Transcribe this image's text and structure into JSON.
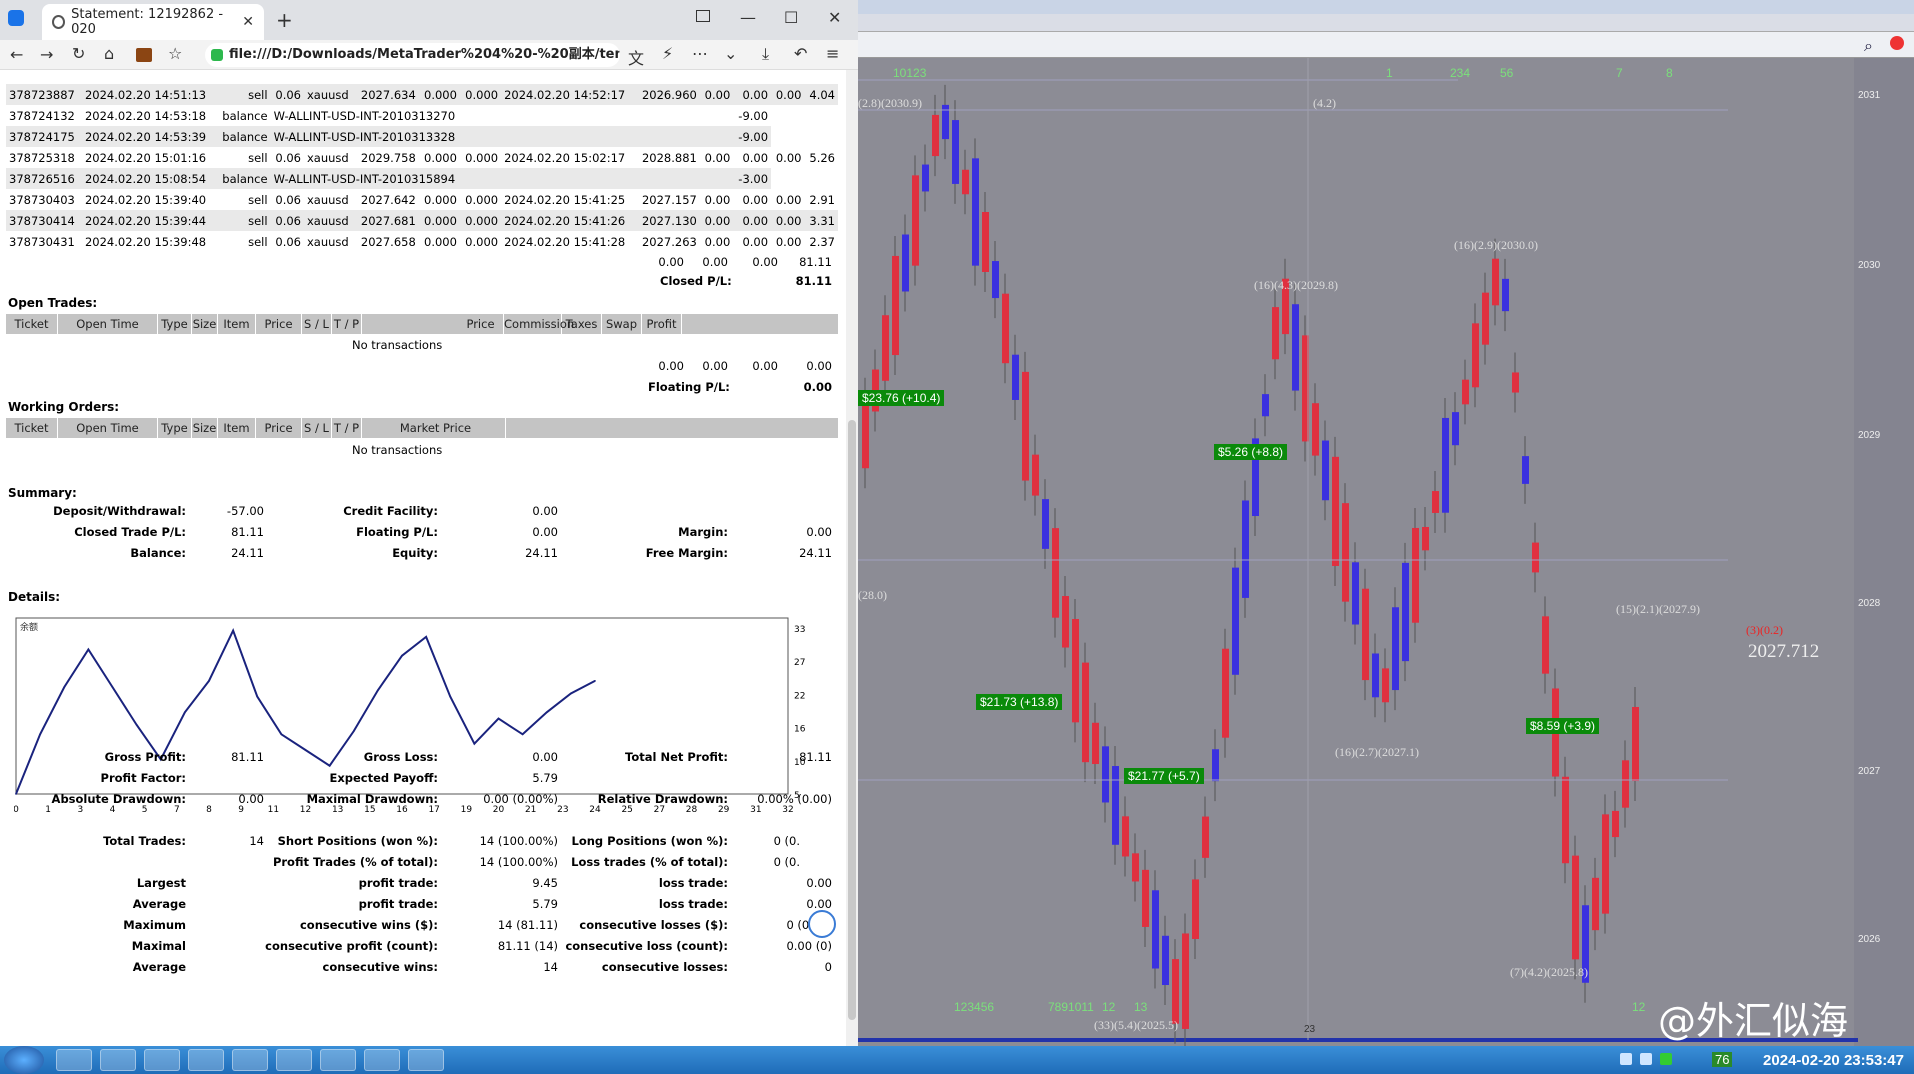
{
  "browser": {
    "tab_title": "Statement: 12192862 - 020",
    "tab_close": "✕",
    "new_tab": "+",
    "url": "file:///D:/Downloads/MetaTrader%204%20-%20副本/templ",
    "win_min": "—",
    "win_max": "☐",
    "win_close": "✕"
  },
  "transactions": [
    {
      "ticket": "378723887",
      "open_time": "2024.02.20 14:51:13",
      "type": "sell",
      "size": "0.06",
      "item": "xauusd",
      "price": "2027.634",
      "sl": "0.000",
      "tp": "0.000",
      "close_time": "2024.02.20 14:52:17",
      "close_price": "2026.960",
      "commission": "0.00",
      "taxes": "0.00",
      "swap": "0.00",
      "profit": "4.04"
    },
    {
      "ticket": "378724132",
      "open_time": "2024.02.20 14:53:18",
      "type": "balance",
      "item": "W-ALLINT-USD-INT-2010313270",
      "profit": "-9.00"
    },
    {
      "ticket": "378724175",
      "open_time": "2024.02.20 14:53:39",
      "type": "balance",
      "item": "W-ALLINT-USD-INT-2010313328",
      "profit": "-9.00"
    },
    {
      "ticket": "378725318",
      "open_time": "2024.02.20 15:01:16",
      "type": "sell",
      "size": "0.06",
      "item": "xauusd",
      "price": "2029.758",
      "sl": "0.000",
      "tp": "0.000",
      "close_time": "2024.02.20 15:02:17",
      "close_price": "2028.881",
      "commission": "0.00",
      "taxes": "0.00",
      "swap": "0.00",
      "profit": "5.26"
    },
    {
      "ticket": "378726516",
      "open_time": "2024.02.20 15:08:54",
      "type": "balance",
      "item": "W-ALLINT-USD-INT-2010315894",
      "profit": "-3.00"
    },
    {
      "ticket": "378730403",
      "open_time": "2024.02.20 15:39:40",
      "type": "sell",
      "size": "0.06",
      "item": "xauusd",
      "price": "2027.642",
      "sl": "0.000",
      "tp": "0.000",
      "close_time": "2024.02.20 15:41:25",
      "close_price": "2027.157",
      "commission": "0.00",
      "taxes": "0.00",
      "swap": "0.00",
      "profit": "2.91"
    },
    {
      "ticket": "378730414",
      "open_time": "2024.02.20 15:39:44",
      "type": "sell",
      "size": "0.06",
      "item": "xauusd",
      "price": "2027.681",
      "sl": "0.000",
      "tp": "0.000",
      "close_time": "2024.02.20 15:41:26",
      "close_price": "2027.130",
      "commission": "0.00",
      "taxes": "0.00",
      "swap": "0.00",
      "profit": "3.31"
    },
    {
      "ticket": "378730431",
      "open_time": "2024.02.20 15:39:48",
      "type": "sell",
      "size": "0.06",
      "item": "xauusd",
      "price": "2027.658",
      "sl": "0.000",
      "tp": "0.000",
      "close_time": "2024.02.20 15:41:28",
      "close_price": "2027.263",
      "commission": "0.00",
      "taxes": "0.00",
      "swap": "0.00",
      "profit": "2.37"
    }
  ],
  "closed_totals": {
    "commission": "0.00",
    "taxes": "0.00",
    "swap": "0.00",
    "profit": "81.11",
    "label": "Closed P/L:",
    "value": "81.11"
  },
  "open_trades": {
    "title": "Open Trades:",
    "headers": [
      "Ticket",
      "Open Time",
      "Type",
      "Size",
      "Item",
      "Price",
      "S / L",
      "T / P",
      "Price",
      "Commission",
      "Taxes",
      "Swap",
      "Profit"
    ],
    "empty": "No transactions",
    "commission": "0.00",
    "taxes": "0.00",
    "swap": "0.00",
    "profit": "0.00",
    "floating_label": "Floating P/L:",
    "floating_value": "0.00"
  },
  "working_orders": {
    "title": "Working Orders:",
    "headers": [
      "Ticket",
      "Open Time",
      "Type",
      "Size",
      "Item",
      "Price",
      "S / L",
      "T / P",
      "Market Price"
    ],
    "empty": "No transactions"
  },
  "summary": {
    "title": "Summary:",
    "deposit_label": "Deposit/Withdrawal:",
    "deposit": "-57.00",
    "credit_label": "Credit Facility:",
    "credit": "0.00",
    "closed_label": "Closed Trade P/L:",
    "closed": "81.11",
    "floating_label": "Floating P/L:",
    "floating": "0.00",
    "margin_label": "Margin:",
    "margin": "0.00",
    "balance_label": "Balance:",
    "balance": "24.11",
    "equity_label": "Equity:",
    "equity": "24.11",
    "free_margin_label": "Free Margin:",
    "free_margin": "24.11"
  },
  "details": {
    "title": "Details:"
  },
  "chart_data": {
    "type": "line",
    "title": "余额",
    "x": [
      0,
      1,
      2,
      3,
      4,
      5,
      6,
      7,
      8,
      9,
      10,
      11,
      12,
      13,
      14,
      15,
      16,
      17,
      18,
      19,
      20,
      21,
      22,
      23,
      24
    ],
    "values": [
      5,
      14.5,
      22,
      28,
      22,
      16,
      10.5,
      18,
      23,
      31,
      20.5,
      14.5,
      12,
      9.5,
      15,
      21.5,
      27,
      30,
      20.5,
      13,
      17,
      14.5,
      18,
      21,
      23
    ],
    "x_ticks": [
      "0",
      "1",
      "3",
      "4",
      "5",
      "7",
      "8",
      "9",
      "11",
      "12",
      "13",
      "15",
      "16",
      "17",
      "19",
      "20",
      "21",
      "23",
      "24",
      "25",
      "27",
      "28",
      "29",
      "31",
      "32"
    ],
    "y_ticks": [
      "33",
      "27",
      "22",
      "16",
      "10",
      "5"
    ],
    "ylim": [
      5,
      33
    ],
    "xlim": [
      0,
      32
    ],
    "line_color": "#1a237e"
  },
  "stats": {
    "gross_profit_label": "Gross Profit:",
    "gross_profit": "81.11",
    "gross_loss_label": "Gross Loss:",
    "gross_loss": "0.00",
    "total_net_label": "Total Net Profit:",
    "total_net": "81.11",
    "profit_factor_label": "Profit Factor:",
    "profit_factor": "",
    "expected_payoff_label": "Expected Payoff:",
    "expected_payoff": "5.79",
    "abs_dd_label": "Absolute Drawdown:",
    "abs_dd": "0.00",
    "max_dd_label": "Maximal Drawdown:",
    "max_dd": "0.00 (0.00%)",
    "rel_dd_label": "Relative Drawdown:",
    "rel_dd": "0.00% (0.00)",
    "total_trades_label": "Total Trades:",
    "total_trades": "14",
    "short_label": "Short Positions (won %):",
    "short": "14 (100.00%)",
    "long_label": "Long Positions (won %):",
    "long": "0 (0.",
    "profit_trades_label": "Profit Trades (% of total):",
    "profit_trades": "14 (100.00%)",
    "loss_trades_label": "Loss trades (% of total):",
    "loss_trades": "0 (0.",
    "largest_label": "Largest",
    "largest_profit_label": "profit trade:",
    "largest_profit": "9.45",
    "largest_loss_label": "loss trade:",
    "largest_loss": "0.00",
    "average_label": "Average",
    "average_profit_label": "profit trade:",
    "average_profit": "5.79",
    "average_loss_label": "loss trade:",
    "average_loss": "0.00",
    "maximum_label": "Maximum",
    "max_cons_wins_label": "consecutive wins ($):",
    "max_cons_wins": "14 (81.11)",
    "max_cons_losses_label": "consecutive losses ($):",
    "max_cons_losses": "0 (0.00)",
    "maximal_label": "Maximal",
    "maximal_profit_label": "consecutive profit (count):",
    "maximal_profit": "81.11 (14)",
    "maximal_loss_label": "consecutive loss (count):",
    "maximal_loss": "0.00 (0)",
    "average2_label": "Average",
    "avg_cons_wins_label": "consecutive wins:",
    "avg_cons_wins": "14",
    "avg_cons_losses_label": "consecutive losses:",
    "avg_cons_losses": "0"
  },
  "mt4": {
    "current_price": "2027.712",
    "price_levels": [
      "2031",
      "2030",
      "2029",
      "2028",
      "2027",
      "2026"
    ],
    "annotations": [
      "(2.8)(2030.9)",
      "(4.2)",
      "(16)(2.9)(2030.0)",
      "(16)(4.3)(2029.8)",
      "(28.0)",
      "(15)(2.1)(2027.9)",
      "(3)(0.2)",
      "(16)(2.7)(2027.1)",
      "(7)(4.2)(2025.8)",
      "(33)(5.4)(2025.5)"
    ],
    "green_boxes": [
      "$23.76 (+10.4)",
      "$5.26 (+8.8)",
      "$21.73 (+13.8)",
      "$21.77 (+5.7)",
      "$8.59 (+3.9)"
    ],
    "top_counts": [
      "10123",
      "1",
      "234",
      "56",
      "7",
      "8"
    ],
    "bottom_counts": [
      "123456",
      "7891011",
      "12",
      "13",
      "12"
    ],
    "bottom_number": "23",
    "watermark": "@外汇似海"
  },
  "taskbar": {
    "clock": "2024-02-20 23:53:47",
    "tray_num": "76"
  }
}
